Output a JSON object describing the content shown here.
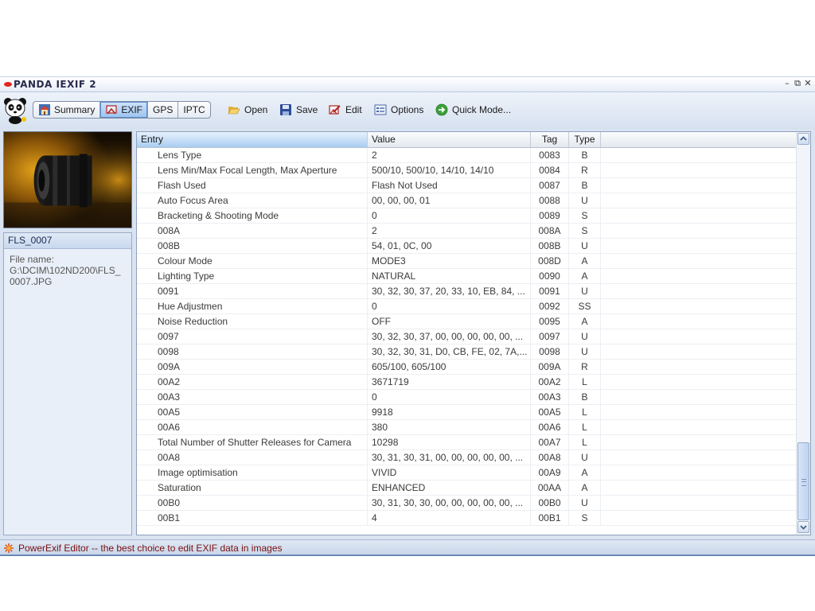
{
  "window": {
    "title": "PANDA IEXIF 2",
    "controls": [
      "–",
      "⧉",
      "✕"
    ]
  },
  "toolbar": {
    "tabs": [
      {
        "label": "Summary",
        "icon": "house-icon",
        "active": false
      },
      {
        "label": "EXIF",
        "icon": "exif-icon",
        "active": true
      },
      {
        "label": "GPS",
        "icon": "",
        "active": false
      },
      {
        "label": "IPTC",
        "icon": "",
        "active": false
      }
    ],
    "open_label": "Open",
    "save_label": "Save",
    "edit_label": "Edit",
    "options_label": "Options",
    "quick_mode_label": "Quick Mode..."
  },
  "sidebar": {
    "file_title": "FLS_0007",
    "file_name_label": "File name:",
    "file_name_value": "G:\\DCIM\\102ND200\\FLS_0007.JPG"
  },
  "grid": {
    "columns": {
      "entry": "Entry",
      "value": "Value",
      "tag": "Tag",
      "type": "Type"
    },
    "rows": [
      {
        "entry": "Lens Type",
        "value": "2",
        "tag": "0083",
        "type": "B"
      },
      {
        "entry": "Lens Min/Max Focal Length, Max Aperture",
        "value": "500/10, 500/10, 14/10, 14/10",
        "tag": "0084",
        "type": "R"
      },
      {
        "entry": "Flash Used",
        "value": "Flash Not Used",
        "tag": "0087",
        "type": "B"
      },
      {
        "entry": "Auto Focus Area",
        "value": "00, 00, 00, 01",
        "tag": "0088",
        "type": "U"
      },
      {
        "entry": "Bracketing & Shooting Mode",
        "value": "0",
        "tag": "0089",
        "type": "S"
      },
      {
        "entry": "008A",
        "value": "2",
        "tag": "008A",
        "type": "S"
      },
      {
        "entry": "008B",
        "value": "54, 01, 0C, 00",
        "tag": "008B",
        "type": "U"
      },
      {
        "entry": "Colour Mode",
        "value": "MODE3",
        "tag": "008D",
        "type": "A"
      },
      {
        "entry": "Lighting Type",
        "value": "NATURAL",
        "tag": "0090",
        "type": "A"
      },
      {
        "entry": "0091",
        "value": "30, 32, 30, 37, 20, 33, 10, EB, 84, ...",
        "tag": "0091",
        "type": "U"
      },
      {
        "entry": "Hue Adjustmen",
        "value": "0",
        "tag": "0092",
        "type": "SS"
      },
      {
        "entry": "Noise Reduction",
        "value": "OFF",
        "tag": "0095",
        "type": "A"
      },
      {
        "entry": "0097",
        "value": "30, 32, 30, 37, 00, 00, 00, 00, 00, ...",
        "tag": "0097",
        "type": "U"
      },
      {
        "entry": "0098",
        "value": "30, 32, 30, 31, D0, CB, FE, 02, 7A,...",
        "tag": "0098",
        "type": "U"
      },
      {
        "entry": "009A",
        "value": "605/100, 605/100",
        "tag": "009A",
        "type": "R"
      },
      {
        "entry": "00A2",
        "value": "3671719",
        "tag": "00A2",
        "type": "L"
      },
      {
        "entry": "00A3",
        "value": "0",
        "tag": "00A3",
        "type": "B"
      },
      {
        "entry": "00A5",
        "value": "9918",
        "tag": "00A5",
        "type": "L"
      },
      {
        "entry": "00A6",
        "value": "380",
        "tag": "00A6",
        "type": "L"
      },
      {
        "entry": "Total Number of Shutter Releases for Camera",
        "value": "10298",
        "tag": "00A7",
        "type": "L"
      },
      {
        "entry": "00A8",
        "value": "30, 31, 30, 31, 00, 00, 00, 00, 00, ...",
        "tag": "00A8",
        "type": "U"
      },
      {
        "entry": "Image optimisation",
        "value": "VIVID",
        "tag": "00A9",
        "type": "A"
      },
      {
        "entry": "Saturation",
        "value": "ENHANCED",
        "tag": "00AA",
        "type": "A"
      },
      {
        "entry": "00B0",
        "value": "30, 31, 30, 30, 00, 00, 00, 00, 00, ...",
        "tag": "00B0",
        "type": "U"
      },
      {
        "entry": "00B1",
        "value": "4",
        "tag": "00B1",
        "type": "S"
      }
    ]
  },
  "status": {
    "text": "PowerExif Editor -- the best choice to edit EXIF data in images"
  },
  "colors": {
    "accent": "#9cc3f0",
    "status_text": "#7a1010",
    "logo_red": "#e1261c"
  }
}
